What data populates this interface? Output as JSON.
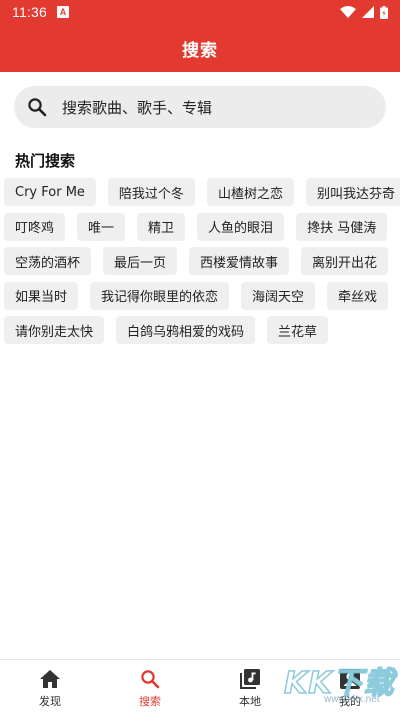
{
  "status_bar": {
    "time": "11:36",
    "notification_badge": "A"
  },
  "header": {
    "title": "搜索"
  },
  "search": {
    "placeholder": "搜索歌曲、歌手、专辑"
  },
  "hot_search": {
    "title": "热门搜索",
    "rows": [
      [
        "Cry For Me",
        "陪我过个冬",
        "山楂树之恋",
        "别叫我达芬奇"
      ],
      [
        "叮咚鸡",
        "唯一",
        "精卫",
        "人鱼的眼泪",
        "搀扶 马健涛"
      ],
      [
        "空荡的酒杯",
        "最后一页",
        "西楼爱情故事",
        "离别开出花"
      ],
      [
        "如果当时",
        "我记得你眼里的依恋",
        "海阔天空",
        "牵丝戏"
      ],
      [
        "请你别走太快",
        "白鸽乌鸦相爱的戏码",
        "兰花草"
      ]
    ]
  },
  "bottom_nav": {
    "items": [
      {
        "label": "发现",
        "icon": "home-icon",
        "active": false
      },
      {
        "label": "搜索",
        "icon": "search-icon",
        "active": true
      },
      {
        "label": "本地",
        "icon": "music-library-icon",
        "active": false
      },
      {
        "label": "我的",
        "icon": "person-icon",
        "active": false
      }
    ]
  },
  "watermark": {
    "logo_text": "KK下载",
    "url": "www.kkx.net"
  },
  "colors": {
    "brand": "#e23a31",
    "chip_bg": "#efefef",
    "search_bg": "#ececec"
  }
}
